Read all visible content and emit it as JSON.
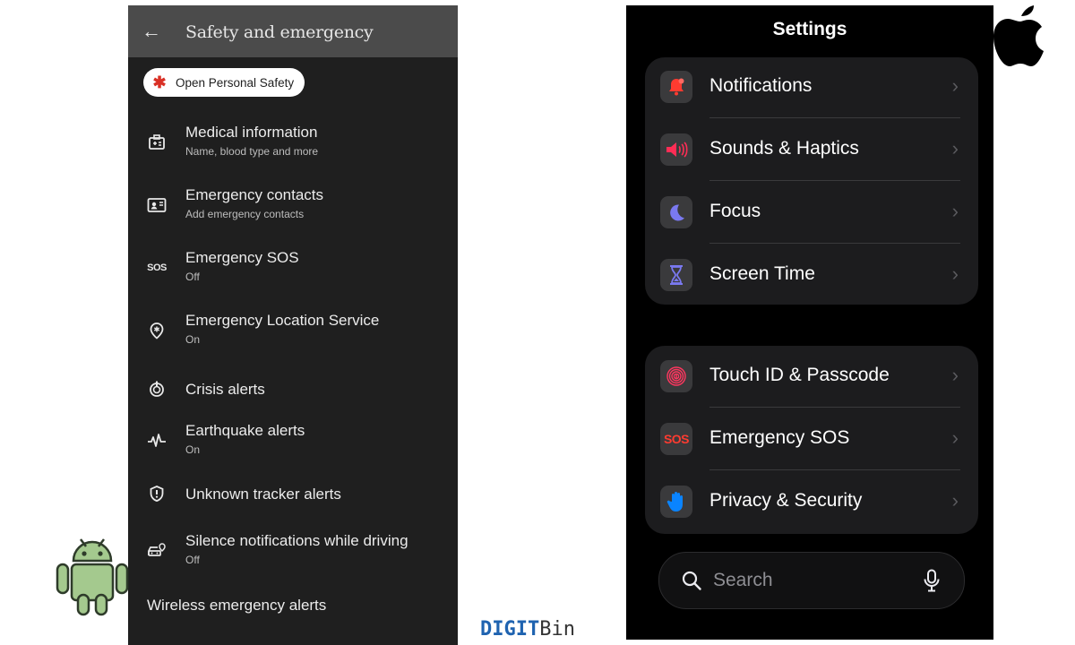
{
  "android": {
    "header_title": "Safety and emergency",
    "personal_safety_label": "Open Personal Safety",
    "items": [
      {
        "title": "Medical information",
        "subtitle": "Name, blood type and more",
        "icon": "medical-card-icon"
      },
      {
        "title": "Emergency contacts",
        "subtitle": "Add emergency contacts",
        "icon": "contact-card-icon"
      },
      {
        "title": "Emergency SOS",
        "subtitle": "Off",
        "icon": "sos-icon"
      },
      {
        "title": "Emergency Location Service",
        "subtitle": "On",
        "icon": "location-pin-icon"
      },
      {
        "title": "Crisis alerts",
        "subtitle": "",
        "icon": "crisis-alert-icon"
      },
      {
        "title": "Earthquake alerts",
        "subtitle": "On",
        "icon": "earthquake-wave-icon"
      },
      {
        "title": "Unknown tracker alerts",
        "subtitle": "",
        "icon": "tracker-shield-icon"
      },
      {
        "title": "Silence notifications while driving",
        "subtitle": "Off",
        "icon": "car-location-icon"
      }
    ],
    "wireless_label": "Wireless emergency alerts",
    "sos_glyph": "SOS"
  },
  "ios": {
    "title": "Settings",
    "group1": [
      {
        "label": "Notifications",
        "icon": "bell-icon",
        "color": "#ff3b30"
      },
      {
        "label": "Sounds & Haptics",
        "icon": "speaker-icon",
        "color": "#ff2d55"
      },
      {
        "label": "Focus",
        "icon": "moon-icon",
        "color": "#5e5ce6"
      },
      {
        "label": "Screen Time",
        "icon": "hourglass-icon",
        "color": "#5e5ce6"
      }
    ],
    "group2": [
      {
        "label": "Touch ID & Passcode",
        "icon": "fingerprint-icon",
        "color": "#ff375f"
      },
      {
        "label": "Emergency SOS",
        "icon": "sos-icon",
        "color": "#ff3b30",
        "glyph": "SOS"
      },
      {
        "label": "Privacy & Security",
        "icon": "hand-icon",
        "color": "#0a84ff"
      }
    ],
    "search_placeholder": "Search",
    "chevron": "›"
  },
  "watermark": {
    "part1": "DIGIT",
    "part2": "Bin"
  }
}
